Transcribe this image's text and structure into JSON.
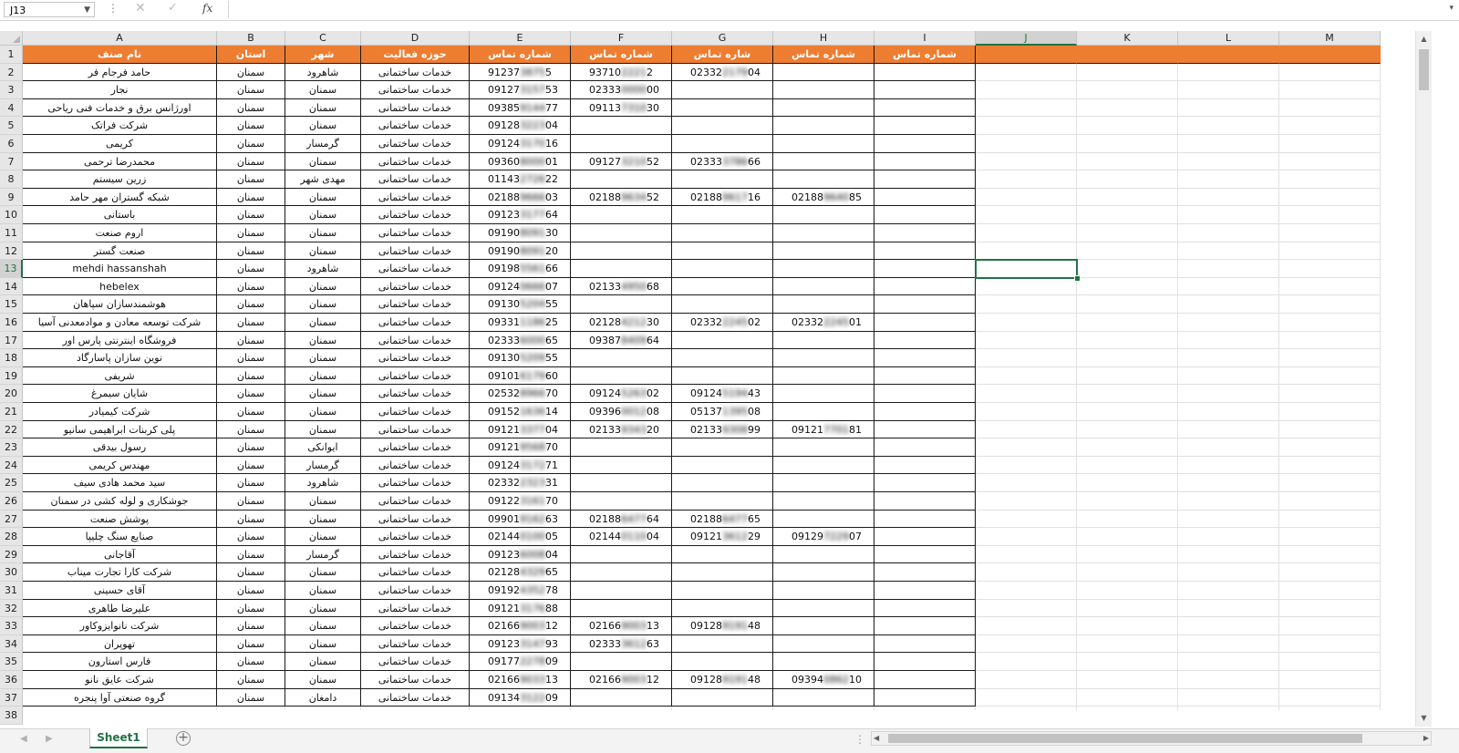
{
  "formula_bar": {
    "name_box": "J13",
    "fx_label": "fx",
    "formula": ""
  },
  "colors": {
    "header_fill": "#ed7d31",
    "selection": "#217346"
  },
  "icons": {
    "cancel": "close-icon",
    "enter": "check-icon",
    "function": "fx-icon",
    "add_sheet": "plus-circle-icon"
  },
  "columns": [
    "A",
    "B",
    "C",
    "D",
    "E",
    "F",
    "G",
    "H",
    "I",
    "J",
    "K",
    "L",
    "M"
  ],
  "selected": {
    "column": "J",
    "row": 13
  },
  "header_row": [
    "نام صنف",
    "استان",
    "شهر",
    "حوزه فعالیت",
    "شماره تماس",
    "شماره تماس",
    "شاره تماس",
    "شماره تماس",
    "شماره تماس"
  ],
  "rows": [
    [
      "حامد فرجام فر",
      "سمنان",
      "شاهرود",
      "خدمات ساختمانی",
      "9123738755",
      "9371022212",
      "02332217904",
      ""
    ],
    [
      "نجار",
      "سمنان",
      "سمنان",
      "خدمات ساختمانی",
      "09127315753",
      "02333000000",
      "",
      ""
    ],
    [
      "اورژانس برق و خدمات فنی ریاحی",
      "سمنان",
      "سمنان",
      "خدمات ساختمانی",
      "09385914477",
      "09113731030",
      "",
      ""
    ],
    [
      "شرکت فراتک",
      "سمنان",
      "سمنان",
      "خدمات ساختمانی",
      "09128322304",
      "",
      "",
      ""
    ],
    [
      "کریمی",
      "سمنان",
      "گرمسار",
      "خدمات ساختمانی",
      "09124317016",
      "",
      "",
      ""
    ],
    [
      "محمدرضا ترحمی",
      "سمنان",
      "سمنان",
      "خدمات ساختمانی",
      "09360800001",
      "09127321052",
      "02333378666",
      ""
    ],
    [
      "زرین سیستم",
      "سمنان",
      "مهدی شهر",
      "خدمات ساختمانی",
      "01143272622",
      "",
      "",
      ""
    ],
    [
      "شبکه گستران مهر حامد",
      "سمنان",
      "سمنان",
      "خدمات ساختمانی",
      "02188966603",
      "02188963452",
      "02188961716",
      "02188964085"
    ],
    [
      "باستانی",
      "سمنان",
      "سمنان",
      "خدمات ساختمانی",
      "09123317764",
      "",
      "",
      ""
    ],
    [
      "اروم صنعت",
      "سمنان",
      "سمنان",
      "خدمات ساختمانی",
      "09190809130",
      "",
      "",
      ""
    ],
    [
      "صنعت گستر",
      "سمنان",
      "سمنان",
      "خدمات ساختمانی",
      "09190809120",
      "",
      "",
      ""
    ],
    [
      "mehdi hassanshah",
      "سمنان",
      "شاهرود",
      "خدمات ساختمانی",
      "09198556166",
      "",
      "",
      ""
    ],
    [
      "hebelex",
      "سمنان",
      "سمنان",
      "خدمات ساختمانی",
      "09124066607",
      "02133495068",
      "",
      ""
    ],
    [
      "هوشمندسازان سپاهان",
      "سمنان",
      "سمنان",
      "خدمات ساختمانی",
      "09130520455",
      "",
      "",
      ""
    ],
    [
      "شرکت توسعه معادن و موادمعدنی آسیا",
      "سمنان",
      "سمنان",
      "خدمات ساختمانی",
      "09331118625",
      "02128421230",
      "02332224502",
      "02332224501"
    ],
    [
      "فروشگاه اینترنتی پارس اور",
      "سمنان",
      "سمنان",
      "خدمات ساختمانی",
      "02333600065",
      "09387840964",
      "",
      ""
    ],
    [
      "نوین سازان پاسارگاد",
      "سمنان",
      "سمنان",
      "خدمات ساختمانی",
      "09130520955",
      "",
      "",
      ""
    ],
    [
      "شریفی",
      "سمنان",
      "سمنان",
      "خدمات ساختمانی",
      "09101617960",
      "",
      "",
      ""
    ],
    [
      "شایان سیمرغ",
      "سمنان",
      "سمنان",
      "خدمات ساختمانی",
      "02532896670",
      "09124526302",
      "09124519443",
      ""
    ],
    [
      "شرکت کیمیادر",
      "سمنان",
      "سمنان",
      "خدمات ساختمانی",
      "09152163614",
      "09396001208",
      "05137139508",
      ""
    ],
    [
      "پلی کربنات ابراهیمی سانیو",
      "سمنان",
      "سمنان",
      "خدمات ساختمانی",
      "09121337704",
      "02133934320",
      "02133930899",
      "09121770181"
    ],
    [
      "رسول بیدقی",
      "سمنان",
      "ایوانکی",
      "خدمات ساختمانی",
      "09121956870",
      "",
      "",
      ""
    ],
    [
      "مهندس کریمی",
      "سمنان",
      "گرمسار",
      "خدمات ساختمانی",
      "09124317271",
      "",
      "",
      ""
    ],
    [
      "سید محمد هادی سیف",
      "سمنان",
      "شاهرود",
      "خدمات ساختمانی",
      "02332232331",
      "",
      "",
      ""
    ],
    [
      "جوشکاری و لوله کشی در سمنان",
      "سمنان",
      "سمنان",
      "خدمات ساختمانی",
      "09122316170",
      "",
      "",
      ""
    ],
    [
      "پوشش صنعت",
      "سمنان",
      "سمنان",
      "خدمات ساختمانی",
      "09901916263",
      "02188647764",
      "02188647765",
      ""
    ],
    [
      "صنایع سنگ چلیپا",
      "سمنان",
      "سمنان",
      "خدمات ساختمانی",
      "02144010005",
      "02144011004",
      "09121361229",
      "09129722907"
    ],
    [
      "آقاجانی",
      "سمنان",
      "گرمسار",
      "خدمات ساختمانی",
      "09123600804",
      "",
      "",
      ""
    ],
    [
      "شرکت کارا تجارت میناب",
      "سمنان",
      "سمنان",
      "خدمات ساختمانی",
      "02128432965",
      "",
      "",
      ""
    ],
    [
      "آقای حسینی",
      "سمنان",
      "سمنان",
      "خدمات ساختمانی",
      "09192435278",
      "",
      "",
      ""
    ],
    [
      "علیرضا طاهری",
      "سمنان",
      "سمنان",
      "خدمات ساختمانی",
      "09121317688",
      "",
      "",
      ""
    ],
    [
      "شرکت نانوایزوکاور",
      "سمنان",
      "سمنان",
      "خدمات ساختمانی",
      "02166900312",
      "02166900313",
      "09128919148",
      ""
    ],
    [
      "تهوپران",
      "سمنان",
      "سمنان",
      "خدمات ساختمانی",
      "09123314793",
      "02333361263",
      "",
      ""
    ],
    [
      "فارس استارون",
      "سمنان",
      "سمنان",
      "خدمات ساختمانی",
      "09177227809",
      "",
      "",
      ""
    ],
    [
      "شرکت عایق نانو",
      "سمنان",
      "سمنان",
      "خدمات ساختمانی",
      "02166903313",
      "02166900312",
      "09128919148",
      "09394086210"
    ],
    [
      "گروه صنعتی آوا پنجره",
      "سمنان",
      "دامغان",
      "خدمات ساختمانی",
      "09134312209",
      "",
      "",
      ""
    ],
    [
      "",
      "",
      "",
      "",
      "",
      "",
      "",
      ""
    ]
  ],
  "sheet_tabs": [
    "Sheet1"
  ]
}
